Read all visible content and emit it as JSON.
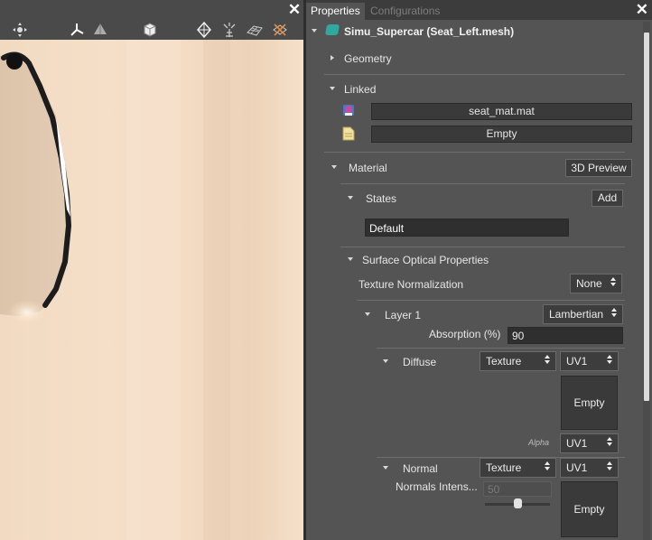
{
  "viewport": {
    "toolbar_icons": [
      "move-gizmo-icon",
      "axes-icon",
      "grid-plane-icon",
      "cube-icon",
      "target-icon",
      "sun-ray-icon",
      "grid-mesh-icon",
      "light-off-icon"
    ],
    "close_label": "✕"
  },
  "properties_panel": {
    "tabs": [
      {
        "label": "Properties",
        "active": true
      },
      {
        "label": "Configurations",
        "active": false
      }
    ],
    "close_label": "✕",
    "root": {
      "label": "Simu_Supercar (Seat_Left.mesh)"
    },
    "geometry": {
      "label": "Geometry"
    },
    "linked": {
      "label": "Linked",
      "items": [
        {
          "icon": "material-icon",
          "value": "seat_mat.mat"
        },
        {
          "icon": "file-icon",
          "value": "Empty"
        }
      ]
    },
    "material": {
      "label": "Material",
      "preview_button": "3D Preview",
      "states": {
        "label": "States",
        "add_button": "Add",
        "current": "Default"
      },
      "surface_optical": {
        "label": "Surface Optical Properties",
        "texture_normalization_label": "Texture Normalization",
        "texture_normalization_value": "None",
        "layer": {
          "label": "Layer 1",
          "type": "Lambertian",
          "absorption_label": "Absorption (%)",
          "absorption_value": "90",
          "diffuse": {
            "label": "Diffuse",
            "source": "Texture",
            "uv": "UV1",
            "thumb": "Empty",
            "alpha_label": "Alpha",
            "alpha_uv": "UV1"
          },
          "normal": {
            "label": "Normal",
            "source": "Texture",
            "uv": "UV1",
            "intensity_label": "Normals Intens...",
            "intensity_value": "50",
            "intensity_fraction": 0.5,
            "thumb": "Empty"
          }
        }
      }
    }
  },
  "colors": {
    "panel_bg": "#545454",
    "field_bg": "#3a3a3a",
    "viewport_bg": "#f4dcc4"
  }
}
